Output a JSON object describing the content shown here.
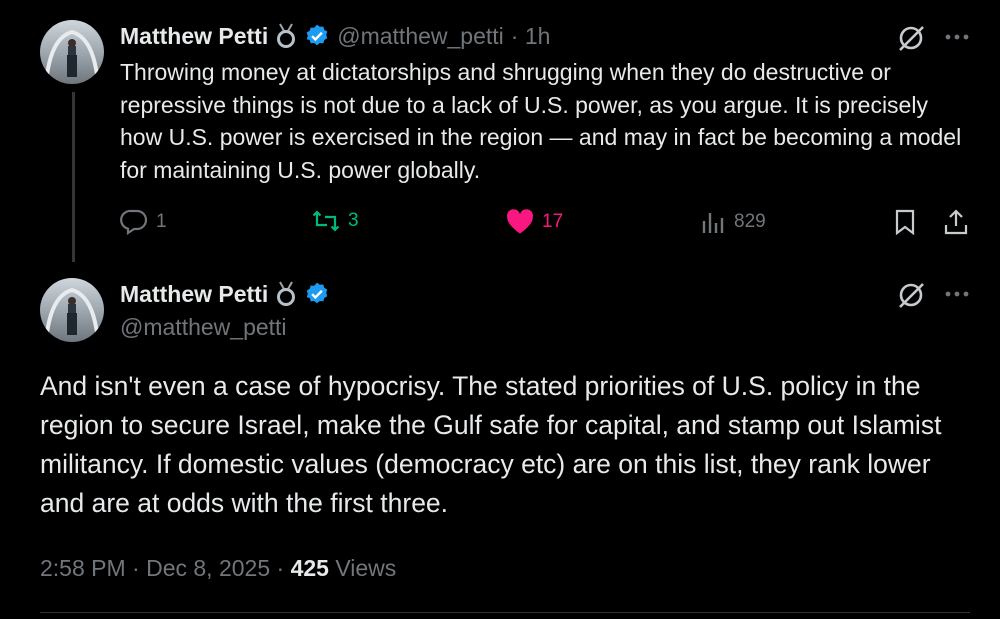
{
  "reply": {
    "author_name": "Matthew Petti",
    "handle": "@matthew_petti",
    "time": "· 1h",
    "text": "Throwing money at dictatorships and shrugging when they do destructive or repressive things is not due to a lack of U.S. power, as you argue. It is precisely how U.S. power is exercised in the region — and may in fact be becoming a model for maintaining U.S. power globally.",
    "stats": {
      "replies": "1",
      "reposts": "3",
      "likes": "17",
      "views": "829"
    }
  },
  "main_post": {
    "author_name": "Matthew Petti",
    "handle": "@matthew_petti",
    "text": "And isn't even a case of hypocrisy. The stated priorities of U.S. policy in the region to secure Israel, make the Gulf safe for capital, and stamp out Islamist militancy. If domestic values (democracy etc) are on this list, they rank lower and are at odds with the first three.",
    "timestamp": "2:58 PM · Dec 8, 2025 · ",
    "views_count": "425",
    "views_label": "Views"
  },
  "colors": {
    "background": "#000000",
    "text": "#e7e9ea",
    "muted": "#71767b",
    "verified": "#1d9bf0",
    "repost": "#00ba7c",
    "like": "#f91880"
  },
  "icons": [
    "medal-icon",
    "verified-badge-icon",
    "grok-icon",
    "more-icon",
    "reply-icon",
    "repost-icon",
    "like-icon",
    "views-icon",
    "bookmark-icon",
    "share-icon"
  ]
}
